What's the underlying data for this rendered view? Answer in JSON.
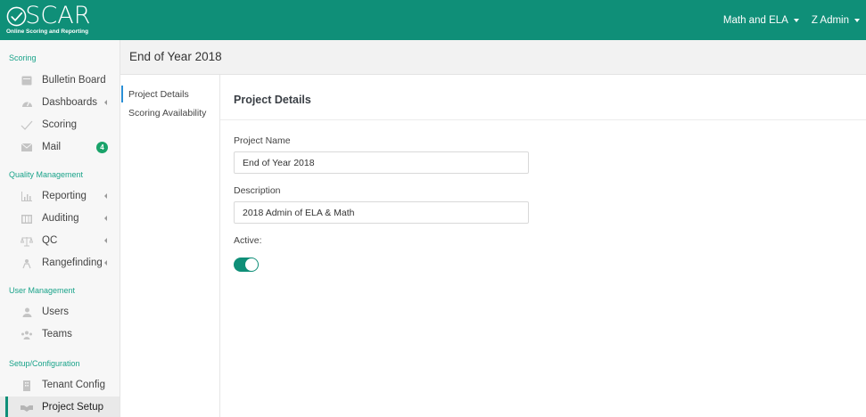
{
  "header": {
    "logo_text": "OSCAR",
    "logo_tagline": "Online Scoring and Reporting",
    "project_menu": "Math and ELA",
    "user_menu": "Z Admin"
  },
  "sidebar": {
    "sections": [
      {
        "label": "Scoring",
        "items": [
          {
            "label": "Bulletin Board",
            "icon": "bulletin-board-icon"
          },
          {
            "label": "Dashboards",
            "icon": "dashboard-gauge-icon",
            "has_submenu": true
          },
          {
            "label": "Scoring",
            "icon": "checkmark-icon"
          },
          {
            "label": "Mail",
            "icon": "envelope-icon",
            "badge": "4"
          }
        ]
      },
      {
        "label": "Quality Management",
        "items": [
          {
            "label": "Reporting",
            "icon": "bar-chart-icon",
            "has_submenu": true
          },
          {
            "label": "Auditing",
            "icon": "columns-icon",
            "has_submenu": true
          },
          {
            "label": "QC",
            "icon": "balance-scale-icon",
            "has_submenu": true
          },
          {
            "label": "Rangefinding",
            "icon": "person-target-icon",
            "has_submenu": true
          }
        ]
      },
      {
        "label": "User Management",
        "items": [
          {
            "label": "Users",
            "icon": "user-icon"
          },
          {
            "label": "Teams",
            "icon": "group-icon"
          }
        ]
      },
      {
        "label": "Setup/Configuration",
        "items": [
          {
            "label": "Tenant Config",
            "icon": "building-icon"
          },
          {
            "label": "Project Setup",
            "icon": "handshake-icon",
            "active": true
          }
        ]
      }
    ]
  },
  "page": {
    "title": "End of Year 2018"
  },
  "subnav": {
    "items": [
      {
        "label": "Project Details",
        "active": true
      },
      {
        "label": "Scoring Availability"
      }
    ]
  },
  "form": {
    "heading": "Project Details",
    "project_name_label": "Project Name",
    "project_name_value": "End of Year 2018",
    "description_label": "Description",
    "description_value": "2018 Admin of ELA & Math",
    "active_label": "Active:",
    "active": true
  },
  "colors": {
    "brand": "#0f8f78",
    "accent_text": "#1aa38a",
    "badge": "#1aa36a",
    "subnav_active": "#2a8fd6"
  }
}
